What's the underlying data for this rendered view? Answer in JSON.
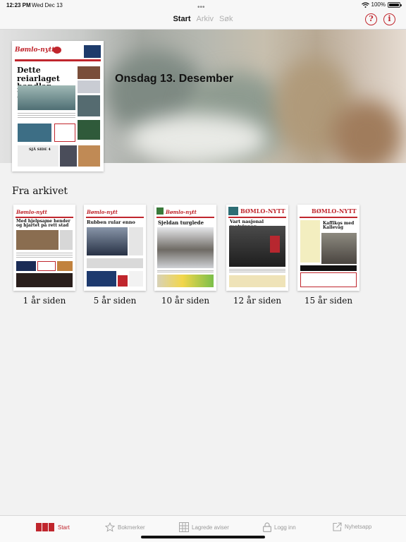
{
  "status": {
    "time": "12:23 PM",
    "date": "Wed Dec 13",
    "battery_text": "100%",
    "battery_level": 1.0
  },
  "nav": {
    "dots": "•••",
    "tabs": [
      {
        "label": "Start",
        "active": true
      },
      {
        "label": "Arkiv",
        "active": false
      },
      {
        "label": "Søk",
        "active": false
      }
    ],
    "help_label": "?",
    "info_label": "i"
  },
  "hero": {
    "title": "Onsdag 13. Desember",
    "cover": {
      "masthead": "Bømlo-nytt",
      "headline": "Dette reiarlaget handlar lokalt",
      "sub_headline": "SJÅ SIDE 4"
    }
  },
  "archive": {
    "title": "Fra arkivet",
    "items": [
      {
        "label": "1 år siden",
        "masthead": "Bømlo-nytt",
        "headline": "Med hjelpsame hender og hjartet på rett stad"
      },
      {
        "label": "5 år siden",
        "masthead": "Bømlo-nytt",
        "headline": "Rubben rular enno"
      },
      {
        "label": "10 år siden",
        "masthead": "Bømlo-nytt",
        "headline": "Sjeldan turglede"
      },
      {
        "label": "12 år siden",
        "masthead": "BØMLO-NYTT",
        "headline": "Vart nasjonal matvinnar"
      },
      {
        "label": "15 år siden",
        "masthead": "BØMLO-NYTT",
        "headline": "Kaffikos med Kallevåg"
      }
    ]
  },
  "tabbar": [
    {
      "label": "Start",
      "icon": "newspaper-icon",
      "active": true
    },
    {
      "label": "Bokmerker",
      "icon": "star-icon",
      "active": false
    },
    {
      "label": "Lagrede aviser",
      "icon": "grid-icon",
      "active": false
    },
    {
      "label": "Logg inn",
      "icon": "lock-icon",
      "active": false
    },
    {
      "label": "Nyhetsapp",
      "icon": "external-link-icon",
      "active": false
    }
  ],
  "colors": {
    "accent": "#c0262d",
    "inactive": "#9a9a9a",
    "background": "#f2f2f2"
  }
}
